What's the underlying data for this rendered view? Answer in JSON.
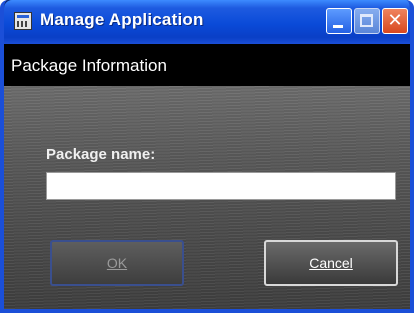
{
  "window": {
    "title": "Manage Application",
    "icon": "app-window-icon",
    "caption_buttons": [
      "minimize-icon",
      "maximize-icon",
      "close-icon"
    ]
  },
  "header": {
    "title": "Package Information"
  },
  "form": {
    "package_name_label": "Package name:",
    "package_name_value": "",
    "package_name_placeholder": ""
  },
  "buttons": {
    "ok_label": "OK",
    "cancel_label": "Cancel"
  },
  "colors": {
    "titlebar": "#0a4ad8",
    "header_band": "#000000",
    "panel": "#555555",
    "close_button": "#d8471e"
  }
}
